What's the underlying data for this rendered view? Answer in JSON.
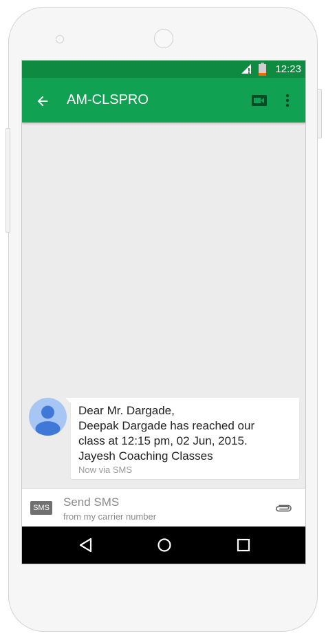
{
  "status_bar": {
    "time": "12:23",
    "icons": [
      "signal-icon",
      "battery-icon"
    ]
  },
  "app_bar": {
    "title": "AM-CLSPRO",
    "back_icon": "back-arrow-icon",
    "video_icon": "video-call-icon",
    "menu_icon": "more-vert-icon"
  },
  "message": {
    "avatar_icon": "person-avatar-icon",
    "lines": [
      "Dear Mr. Dargade,",
      "Deepak Dargade has reached our",
      "class at 12:15 pm, 02 Jun, 2015.",
      "Jayesh Coaching Classes"
    ],
    "meta": "Now via SMS"
  },
  "compose": {
    "badge": "SMS",
    "placeholder": "Send SMS",
    "sub": "from my carrier number",
    "attach_icon": "paperclip-icon"
  },
  "nav_bar": {
    "icons": [
      "nav-back-icon",
      "nav-home-icon",
      "nav-recents-icon"
    ]
  },
  "colors": {
    "status_bar": "#0f8a41",
    "app_bar": "#11a152",
    "avatar_bg": "#a7c6f4",
    "avatar_fg": "#3f78d6"
  }
}
